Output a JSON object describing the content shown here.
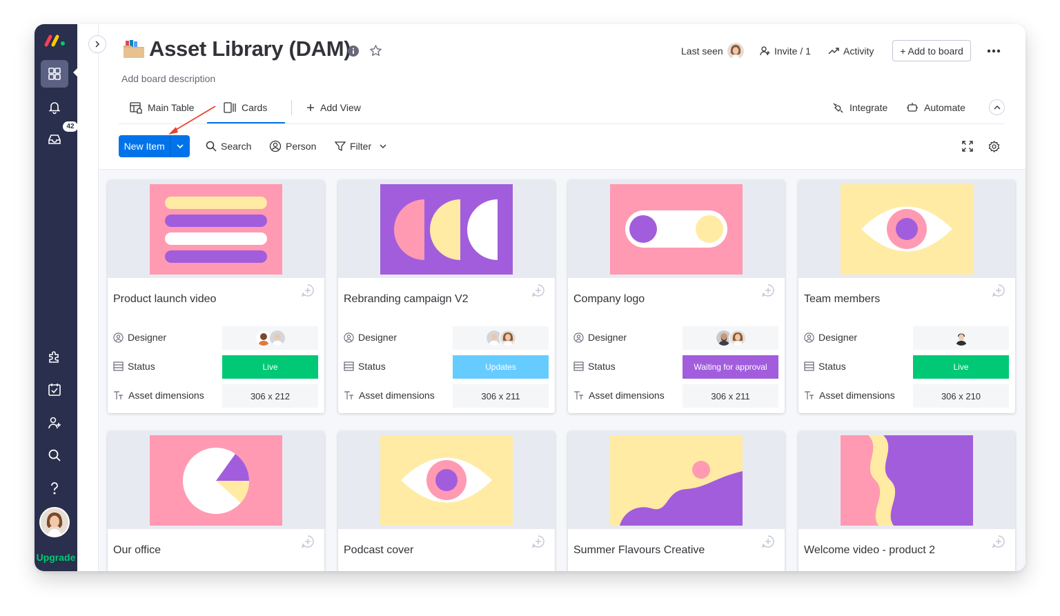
{
  "sidebar": {
    "inbox_badge": "42",
    "upgrade_label": "Upgrade"
  },
  "header": {
    "title": "Asset Library (DAM)",
    "description": "Add board description",
    "last_seen_label": "Last seen",
    "invite_label": "Invite / 1",
    "activity_label": "Activity",
    "add_to_board_label": "+ Add to board"
  },
  "tabs": [
    {
      "label": "Main Table"
    },
    {
      "label": "Cards"
    },
    {
      "label": "Add View"
    }
  ],
  "integrations": {
    "integrate_label": "Integrate",
    "automate_label": "Automate"
  },
  "toolbar": {
    "new_item_label": "New Item",
    "search_label": "Search",
    "person_label": "Person",
    "filter_label": "Filter"
  },
  "fields": {
    "designer": "Designer",
    "status": "Status",
    "dimensions": "Asset dimensions"
  },
  "cards": [
    {
      "name": "Product launch video",
      "status": "Live",
      "status_color": "#00c875",
      "dimensions": "306 x 212"
    },
    {
      "name": "Rebranding campaign V2",
      "status": "Updates",
      "status_color": "#66ccff",
      "dimensions": "306 x 211"
    },
    {
      "name": "Company logo",
      "status": "Waiting for approval",
      "status_color": "#a25ddc",
      "dimensions": "306 x 211"
    },
    {
      "name": "Team members",
      "status": "Live",
      "status_color": "#00c875",
      "dimensions": "306 x 210"
    },
    {
      "name": "Our office"
    },
    {
      "name": "Podcast cover"
    },
    {
      "name": "Summer Flavours Creative"
    },
    {
      "name": "Welcome video - product 2"
    }
  ],
  "colors": {
    "primary": "#0073ea",
    "sidebar": "#292f4c",
    "live": "#00c875",
    "updates": "#66ccff",
    "waiting": "#a25ddc",
    "art_pink": "#ff9ab2",
    "art_purple": "#a25ddc",
    "art_yellow": "#ffeba3",
    "annotation_arrow": "#e8412c"
  }
}
